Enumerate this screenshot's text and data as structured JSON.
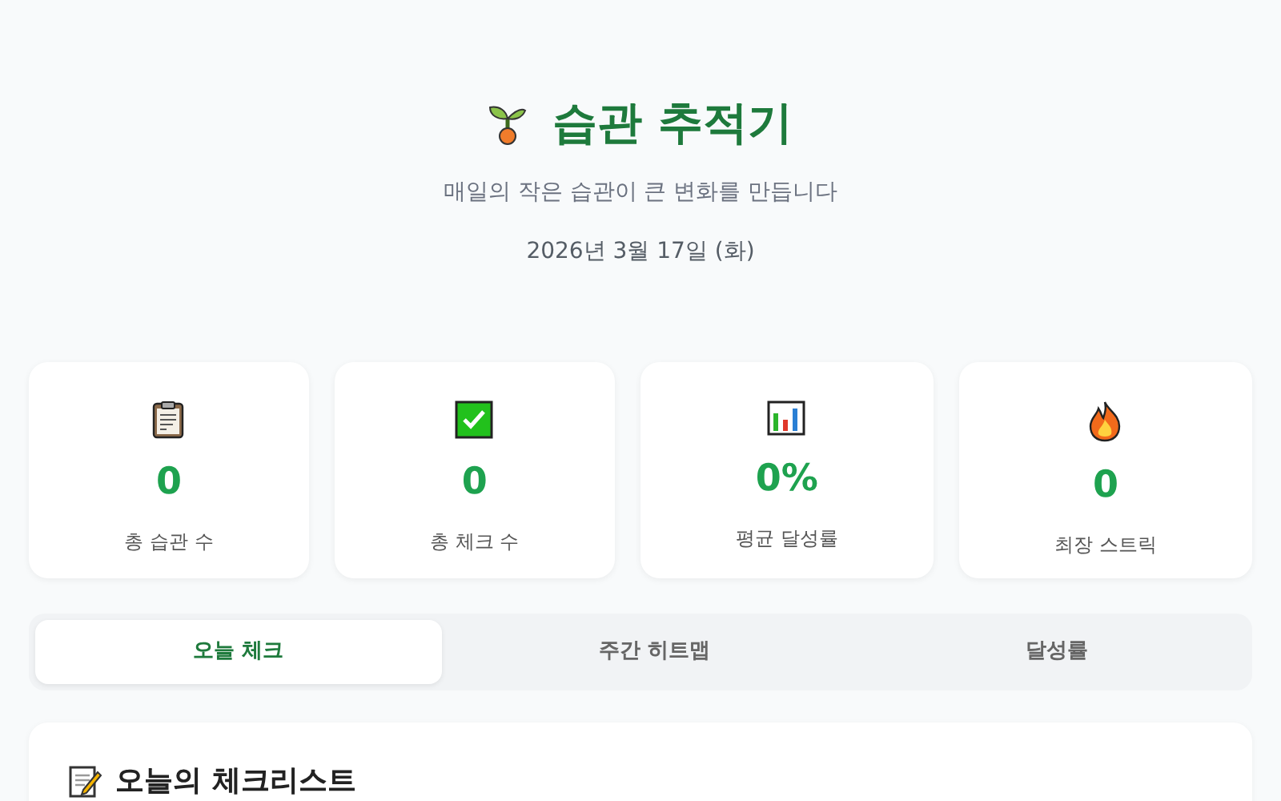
{
  "header": {
    "title": "습관 추적기",
    "subtitle": "매일의 작은 습관이 큰 변화를 만듭니다",
    "date": "2026년 3월 17일 (화)"
  },
  "stats": [
    {
      "value": "0",
      "label": "총 습관 수"
    },
    {
      "value": "0",
      "label": "총 체크 수"
    },
    {
      "value": "0%",
      "label": "평균 달성률"
    },
    {
      "value": "0",
      "label": "최장 스트릭"
    }
  ],
  "tabs": [
    {
      "label": "오늘 체크",
      "selected": true
    },
    {
      "label": "주간 히트맵",
      "selected": false
    },
    {
      "label": "달성률",
      "selected": false
    }
  ],
  "checklist": {
    "title": "오늘의 체크리스트"
  }
}
